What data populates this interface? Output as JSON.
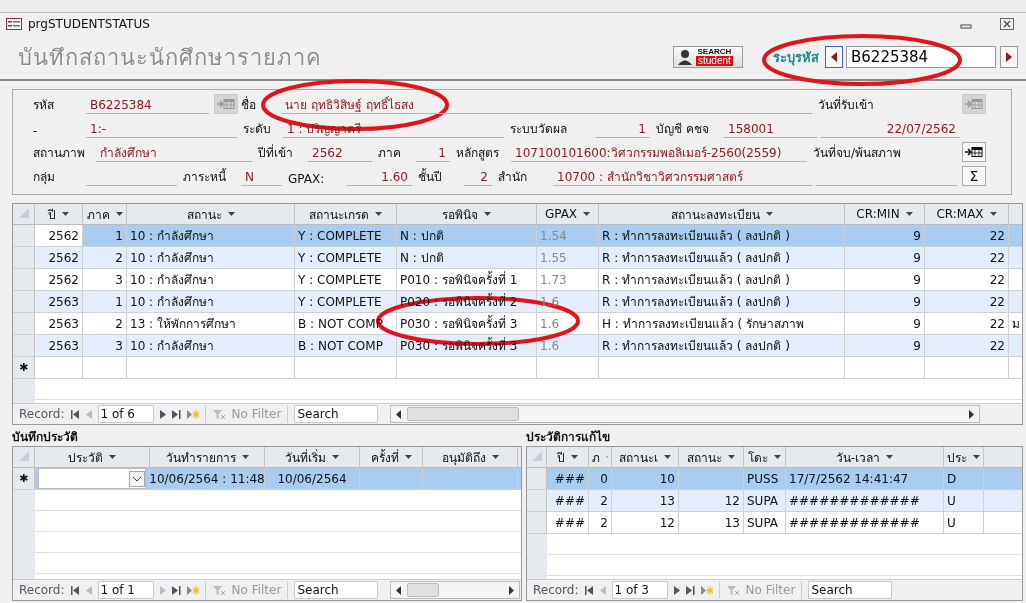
{
  "window": {
    "title": "prgSTUDENTSTATUS"
  },
  "form_title": "บันทึกสถานะนักศึกษารายภาค",
  "search_logo": {
    "line_1": "SEARCH",
    "line_2": "student"
  },
  "lookup": {
    "label": "ระบุรหัส",
    "value": "B6225384"
  },
  "info_rows": [
    [
      {
        "kind": "label",
        "text": "รหัส"
      },
      {
        "kind": "field",
        "value": "B6225384"
      },
      {
        "kind": "icon_button",
        "disabled": true
      },
      {
        "kind": "label",
        "text": "ชื่อ"
      },
      {
        "kind": "field",
        "value": "นาย  ฤทธิวิสิษฐ์  ฤทธิ์ไธสง"
      },
      {
        "kind": "label",
        "text": "วันที่รับเข้า"
      },
      {
        "kind": "icon_button",
        "disabled": true
      }
    ],
    [
      {
        "kind": "label",
        "text": "-"
      },
      {
        "kind": "field",
        "value": "1:-"
      },
      {
        "kind": "label",
        "text": "ระดับ"
      },
      {
        "kind": "field",
        "value": "1 : ปริญญาตรี"
      },
      {
        "kind": "label",
        "text": "ระบบวัดผล"
      },
      {
        "kind": "field",
        "value": "1"
      },
      {
        "kind": "label",
        "text": "บัญชี คชจ"
      },
      {
        "kind": "field",
        "value": "158001"
      },
      {
        "kind": "field",
        "value": "22/07/2562"
      }
    ],
    [
      {
        "kind": "label",
        "text": "สถานภาพ"
      },
      {
        "kind": "field",
        "value": "กำลังศึกษา"
      },
      {
        "kind": "label",
        "text": "ปีที่เข้า"
      },
      {
        "kind": "field",
        "value": "2562"
      },
      {
        "kind": "label",
        "text": "ภาค"
      },
      {
        "kind": "field",
        "value": "1"
      },
      {
        "kind": "label",
        "text": "หลักสูตร"
      },
      {
        "kind": "field",
        "value": "107100101600:วิศวกรรมพอลิเมอร์-2560(2559)"
      },
      {
        "kind": "label",
        "text": "วันที่จบ/พ้นสภาพ"
      },
      {
        "kind": "icon_button",
        "disabled": false
      }
    ],
    [
      {
        "kind": "label",
        "text": "กลุ่ม"
      },
      {
        "kind": "field"
      },
      {
        "kind": "label",
        "text": "ภาระหนี้"
      },
      {
        "kind": "field",
        "value": "N"
      },
      {
        "kind": "label",
        "text": "GPAX:"
      },
      {
        "kind": "field",
        "value": "1.60"
      },
      {
        "kind": "label",
        "text": "ชั้นปี"
      },
      {
        "kind": "field",
        "value": "2"
      },
      {
        "kind": "label",
        "text": "สำนัก"
      },
      {
        "kind": "field",
        "value": "10700 : สำนักวิชาวิศวกรรมศาสตร์"
      },
      {
        "kind": "field"
      },
      {
        "kind": "symbol_button",
        "text": "Σ"
      }
    ]
  ],
  "tables": [
    {
      "columns": [
        {
          "label": "ปี"
        },
        {
          "label": "ภาค"
        },
        {
          "label": "สถานะ"
        },
        {
          "label": "สถานะเกรด"
        },
        {
          "label": "รอพินิจ"
        },
        {
          "label": "GPAX"
        },
        {
          "label": "สถานะลงทะเบียน"
        },
        {
          "label": "CR:MIN"
        },
        {
          "label": "CR:MAX"
        },
        {}
      ],
      "rows": [
        {
          "selected": true,
          "cells": [
            "2562",
            "1",
            "10 : กำลังศึกษา",
            "Y : COMPLETE",
            "N : ปกติ",
            "1.54",
            "R : ทำการลงทะเบียนแล้ว ( ลงปกติ )",
            "9",
            "22",
            null
          ]
        },
        {
          "selected": false,
          "cells": [
            "2562",
            "2",
            "10 : กำลังศึกษา",
            "Y : COMPLETE",
            "N : ปกติ",
            "1.55",
            "R : ทำการลงทะเบียนแล้ว ( ลงปกติ )",
            "9",
            "22",
            null
          ]
        },
        {
          "selected": false,
          "cells": [
            "2562",
            "3",
            "10 : กำลังศึกษา",
            "Y : COMPLETE",
            "P010 : รอพินิจครั้งที่ 1",
            "1.73",
            "R : ทำการลงทะเบียนแล้ว ( ลงปกติ )",
            "9",
            "22",
            null
          ]
        },
        {
          "selected": false,
          "cells": [
            "2563",
            "1",
            "10 : กำลังศึกษา",
            "Y : COMPLETE",
            "P020 : รอพินิจครั้งที่ 2",
            "1.6",
            "R : ทำการลงทะเบียนแล้ว ( ลงปกติ )",
            "9",
            "22",
            null
          ]
        },
        {
          "selected": false,
          "cells": [
            "2563",
            "2",
            "13 : ให้พักการศึกษา",
            "B : NOT COMP",
            "P030 : รอพินิจครั้งที่ 3",
            "1.6",
            "H : ทำการลงทะเบียนแล้ว ( รักษาสภาพ",
            "9",
            "22",
            "ม"
          ]
        },
        {
          "selected": false,
          "cells": [
            "2563",
            "3",
            "10 : กำลังศึกษา",
            "B : NOT COMP",
            "P030 : รอพินิจครั้งที่ 3",
            "1.6",
            "R : ทำการลงทะเบียนแล้ว ( ลงปกติ )",
            "9",
            "22",
            null
          ]
        }
      ],
      "new_row_marker": "✱",
      "nav": {
        "label": "Record:",
        "position": "1 of 6",
        "filter": "No Filter",
        "search": "Search"
      }
    },
    {
      "title": "บันทึกประวัติ",
      "columns": [
        {
          "label": "ประวัติ",
          "kind": "combo"
        },
        {
          "label": "วันทำรายการ"
        },
        {
          "label": "วันที่เริ่ม"
        },
        {
          "label": "ครั้งที่"
        },
        {
          "label": "อนุมัติถึง"
        }
      ],
      "rows": [
        {
          "selected": true,
          "marker": "✱",
          "cells": [
            null,
            "10/06/2564 : 11:48",
            "10/06/2564",
            null,
            null
          ]
        }
      ],
      "nav": {
        "label": "Record:",
        "position": "1 of 1",
        "filter": "No Filter",
        "search": "Search"
      }
    },
    {
      "title": "ประวัติการแก้ไข",
      "columns": [
        {
          "label": "ปี"
        },
        {
          "label": "ภ"
        },
        {
          "label": "สถานะเ"
        },
        {
          "label": "สถานะ"
        },
        {
          "label": "โดะ"
        },
        {
          "label": "วัน-เวลา"
        },
        {
          "label": "ประ"
        }
      ],
      "rows": [
        {
          "selected": true,
          "cells": [
            "###",
            "0",
            "10",
            null,
            "PUSS",
            "17/7/2562 14:41:47",
            "D"
          ]
        },
        {
          "selected": false,
          "cells": [
            "###",
            "2",
            "13",
            "12",
            "SUPA",
            "#############",
            "U"
          ]
        },
        {
          "selected": false,
          "cells": [
            "###",
            "2",
            "12",
            "13",
            "SUPA",
            "#############",
            "U"
          ]
        }
      ],
      "nav": {
        "label": "Record:",
        "position": "1 of 3",
        "filter": "No Filter",
        "search": "Search"
      }
    }
  ]
}
